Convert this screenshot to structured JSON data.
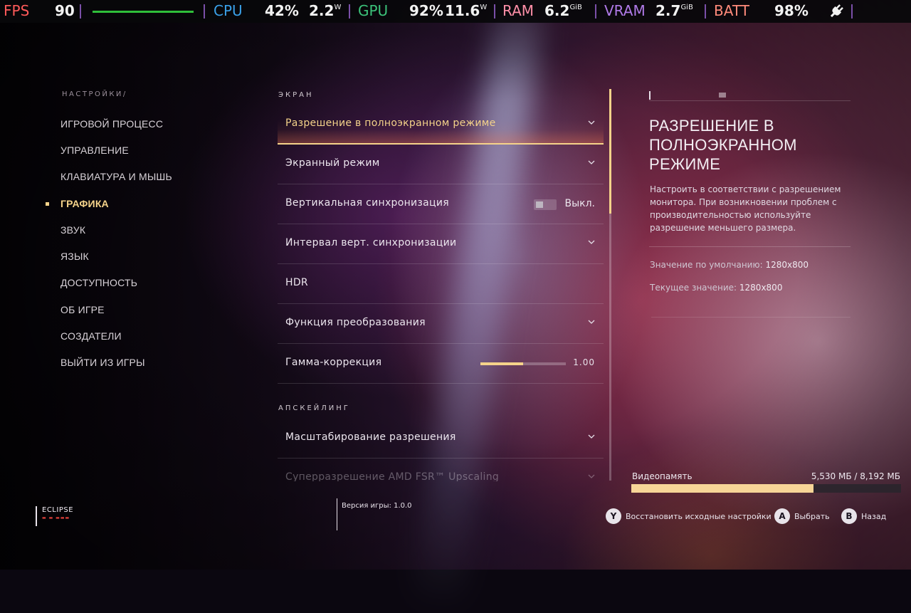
{
  "overlay": {
    "fps_label": "FPS",
    "fps_value": "90",
    "cpu_label": "CPU",
    "cpu_percent": "42%",
    "cpu_power": "2.2",
    "cpu_power_unit": "W",
    "gpu_label": "GPU",
    "gpu_percent": "92%",
    "gpu_power": "11.6",
    "gpu_power_unit": "W",
    "ram_label": "RAM",
    "ram_value": "6.2",
    "ram_unit": "GiB",
    "vram_label": "VRAM",
    "vram_value": "2.7",
    "vram_unit": "GiB",
    "batt_label": "BATT",
    "batt_value": "98%",
    "plug_icon": "plug-icon",
    "colors": {
      "fps": "#ff5a5a",
      "cpu": "#3aa0e8",
      "gpu": "#3cc27a",
      "ram": "#ff8fa8",
      "vram": "#b07ae8",
      "batt": "#ff8a7a"
    }
  },
  "nav": {
    "breadcrumb": "НАСТРОЙКИ/",
    "items": [
      {
        "label": "ИГРОВОЙ ПРОЦЕСС"
      },
      {
        "label": "УПРАВЛЕНИЕ"
      },
      {
        "label": "КЛАВИАТУРА И МЫШЬ"
      },
      {
        "label": "ГРАФИКА",
        "active": true
      },
      {
        "label": "ЗВУК"
      },
      {
        "label": "ЯЗЫК"
      },
      {
        "label": "ДОСТУПНОСТЬ"
      },
      {
        "label": "ОБ ИГРЕ"
      },
      {
        "label": "СОЗДАТЕЛИ"
      },
      {
        "label": "ВЫЙТИ ИЗ ИГРЫ"
      }
    ]
  },
  "settings": {
    "section_screen": "ЭКРАН",
    "section_upscaling": "АПСКЕЙЛИНГ",
    "rows": [
      {
        "label": "Разрешение в полноэкранном режиме"
      },
      {
        "label": "Экранный режим"
      },
      {
        "label": "Вертикальная синхронизация",
        "value": "Выкл."
      },
      {
        "label": "Интервал верт. синхронизации"
      },
      {
        "label": "HDR"
      },
      {
        "label": "Функция преобразования"
      },
      {
        "label": "Гамма-коррекция",
        "value": "1.00",
        "fill_fraction": 0.5
      },
      {
        "label": "Масштабирование разрешения"
      },
      {
        "label": "Суперразрешение AMD FSR™ Upscaling"
      }
    ]
  },
  "detail": {
    "title": "РАЗРЕШЕНИЕ В ПОЛНОЭКРАННОМ РЕЖИМЕ",
    "description": "Настроить в соответствии с разрешением монитора. При возникновении проблем с производительностью используйте разрешение меньшего размера.",
    "default_label": "Значение по умолчанию:",
    "default_value": "1280x800",
    "current_label": "Текущее значение:",
    "current_value": "1280x800"
  },
  "vram": {
    "label": "Видеопамять",
    "value": "5,530 МБ / 8,192 МБ",
    "used_fraction": 0.675
  },
  "footer": {
    "logo_name": "ECLIPSE",
    "version": "Версия игры: 1.0.0",
    "hints": [
      {
        "button": "Y",
        "label": "Восстановить исходные настройки"
      },
      {
        "button": "A",
        "label": "Выбрать"
      },
      {
        "button": "B",
        "label": "Назад"
      }
    ]
  }
}
